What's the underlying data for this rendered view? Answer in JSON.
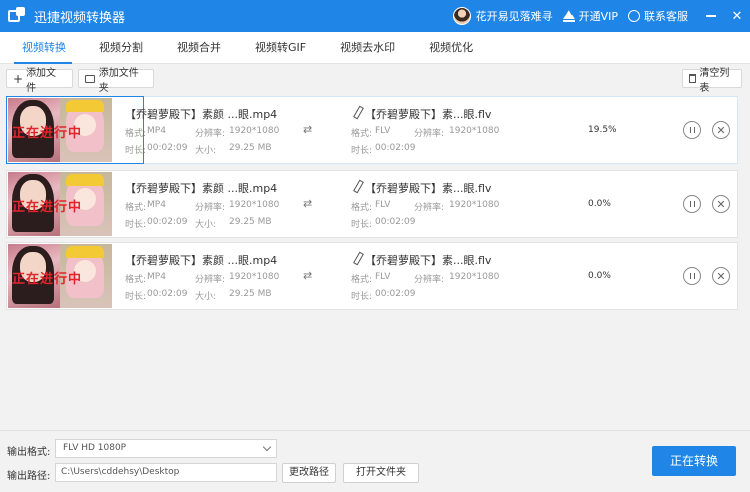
{
  "window": {
    "title": "迅捷视频转换器",
    "user_name": "花开易见落难寻",
    "vip_label": "开通VIP",
    "support_label": "联系客服"
  },
  "tabs": [
    {
      "label": "视频转换",
      "active": true
    },
    {
      "label": "视频分割"
    },
    {
      "label": "视频合并"
    },
    {
      "label": "视频转GIF"
    },
    {
      "label": "视频去水印"
    },
    {
      "label": "视频优化"
    }
  ],
  "toolbar": {
    "add_file": "添加文件",
    "add_folder": "添加文件夹",
    "clear_list": "清空列表"
  },
  "labels": {
    "format": "格式:",
    "resolution": "分辨率:",
    "duration": "时长:",
    "size": "大小:"
  },
  "files": [
    {
      "source_name": "【乔碧萝殿下】素颜 ...眼.mp4",
      "source_format": "MP4",
      "source_resolution": "1920*1080",
      "source_duration": "00:02:09",
      "source_size": "29.25 MB",
      "target_name": "【乔碧萝殿下】素...眼.flv",
      "target_format": "FLV",
      "target_resolution": "1920*1080",
      "target_duration": "00:02:09",
      "progress": "19.5%",
      "thumbnail_text": "正在进行中",
      "selected": true
    },
    {
      "source_name": "【乔碧萝殿下】素颜 ...眼.mp4",
      "source_format": "MP4",
      "source_resolution": "1920*1080",
      "source_duration": "00:02:09",
      "source_size": "29.25 MB",
      "target_name": "【乔碧萝殿下】素...眼.flv",
      "target_format": "FLV",
      "target_resolution": "1920*1080",
      "target_duration": "00:02:09",
      "progress": "0.0%",
      "thumbnail_text": "正在进行中",
      "selected": false
    },
    {
      "source_name": "【乔碧萝殿下】素颜 ...眼.mp4",
      "source_format": "MP4",
      "source_resolution": "1920*1080",
      "source_duration": "00:02:09",
      "source_size": "29.25 MB",
      "target_name": "【乔碧萝殿下】素...眼.flv",
      "target_format": "FLV",
      "target_resolution": "1920*1080",
      "target_duration": "00:02:09",
      "progress": "0.0%",
      "thumbnail_text": "正在进行中",
      "selected": false
    }
  ],
  "bottom": {
    "format_label": "输出格式:",
    "format_value": "FLV  HD 1080P",
    "path_label": "输出路径:",
    "path_value": "C:\\Users\\cddehsy\\Desktop",
    "change_path": "更改路径",
    "open_folder": "打开文件夹",
    "convert_button": "正在转换"
  },
  "colors": {
    "accent": "#1f86e8",
    "background": "#f2f2f2"
  },
  "icons": [
    "app-logo-icon",
    "crown-icon",
    "chat-icon",
    "minimize-icon",
    "close-icon",
    "plus-icon",
    "folder-icon",
    "trash-icon",
    "shuffle-icon",
    "edit-icon",
    "pause-icon",
    "remove-icon",
    "chevron-down-icon"
  ]
}
